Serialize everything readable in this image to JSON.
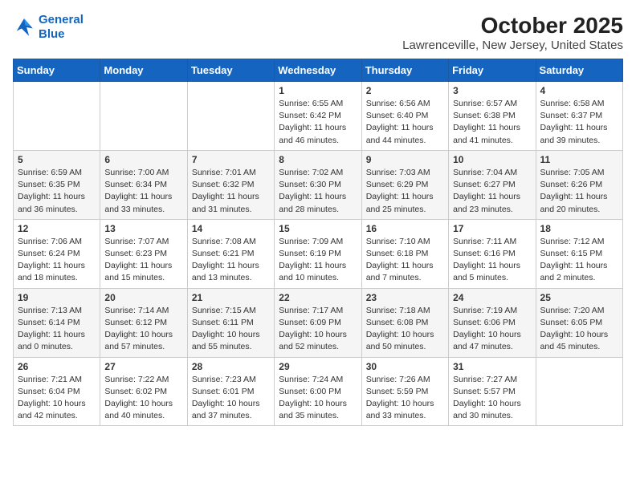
{
  "header": {
    "logo_line1": "General",
    "logo_line2": "Blue",
    "title": "October 2025",
    "subtitle": "Lawrenceville, New Jersey, United States"
  },
  "weekdays": [
    "Sunday",
    "Monday",
    "Tuesday",
    "Wednesday",
    "Thursday",
    "Friday",
    "Saturday"
  ],
  "weeks": [
    [
      {
        "day": "",
        "info": ""
      },
      {
        "day": "",
        "info": ""
      },
      {
        "day": "",
        "info": ""
      },
      {
        "day": "1",
        "info": "Sunrise: 6:55 AM\nSunset: 6:42 PM\nDaylight: 11 hours\nand 46 minutes."
      },
      {
        "day": "2",
        "info": "Sunrise: 6:56 AM\nSunset: 6:40 PM\nDaylight: 11 hours\nand 44 minutes."
      },
      {
        "day": "3",
        "info": "Sunrise: 6:57 AM\nSunset: 6:38 PM\nDaylight: 11 hours\nand 41 minutes."
      },
      {
        "day": "4",
        "info": "Sunrise: 6:58 AM\nSunset: 6:37 PM\nDaylight: 11 hours\nand 39 minutes."
      }
    ],
    [
      {
        "day": "5",
        "info": "Sunrise: 6:59 AM\nSunset: 6:35 PM\nDaylight: 11 hours\nand 36 minutes."
      },
      {
        "day": "6",
        "info": "Sunrise: 7:00 AM\nSunset: 6:34 PM\nDaylight: 11 hours\nand 33 minutes."
      },
      {
        "day": "7",
        "info": "Sunrise: 7:01 AM\nSunset: 6:32 PM\nDaylight: 11 hours\nand 31 minutes."
      },
      {
        "day": "8",
        "info": "Sunrise: 7:02 AM\nSunset: 6:30 PM\nDaylight: 11 hours\nand 28 minutes."
      },
      {
        "day": "9",
        "info": "Sunrise: 7:03 AM\nSunset: 6:29 PM\nDaylight: 11 hours\nand 25 minutes."
      },
      {
        "day": "10",
        "info": "Sunrise: 7:04 AM\nSunset: 6:27 PM\nDaylight: 11 hours\nand 23 minutes."
      },
      {
        "day": "11",
        "info": "Sunrise: 7:05 AM\nSunset: 6:26 PM\nDaylight: 11 hours\nand 20 minutes."
      }
    ],
    [
      {
        "day": "12",
        "info": "Sunrise: 7:06 AM\nSunset: 6:24 PM\nDaylight: 11 hours\nand 18 minutes."
      },
      {
        "day": "13",
        "info": "Sunrise: 7:07 AM\nSunset: 6:23 PM\nDaylight: 11 hours\nand 15 minutes."
      },
      {
        "day": "14",
        "info": "Sunrise: 7:08 AM\nSunset: 6:21 PM\nDaylight: 11 hours\nand 13 minutes."
      },
      {
        "day": "15",
        "info": "Sunrise: 7:09 AM\nSunset: 6:19 PM\nDaylight: 11 hours\nand 10 minutes."
      },
      {
        "day": "16",
        "info": "Sunrise: 7:10 AM\nSunset: 6:18 PM\nDaylight: 11 hours\nand 7 minutes."
      },
      {
        "day": "17",
        "info": "Sunrise: 7:11 AM\nSunset: 6:16 PM\nDaylight: 11 hours\nand 5 minutes."
      },
      {
        "day": "18",
        "info": "Sunrise: 7:12 AM\nSunset: 6:15 PM\nDaylight: 11 hours\nand 2 minutes."
      }
    ],
    [
      {
        "day": "19",
        "info": "Sunrise: 7:13 AM\nSunset: 6:14 PM\nDaylight: 11 hours\nand 0 minutes."
      },
      {
        "day": "20",
        "info": "Sunrise: 7:14 AM\nSunset: 6:12 PM\nDaylight: 10 hours\nand 57 minutes."
      },
      {
        "day": "21",
        "info": "Sunrise: 7:15 AM\nSunset: 6:11 PM\nDaylight: 10 hours\nand 55 minutes."
      },
      {
        "day": "22",
        "info": "Sunrise: 7:17 AM\nSunset: 6:09 PM\nDaylight: 10 hours\nand 52 minutes."
      },
      {
        "day": "23",
        "info": "Sunrise: 7:18 AM\nSunset: 6:08 PM\nDaylight: 10 hours\nand 50 minutes."
      },
      {
        "day": "24",
        "info": "Sunrise: 7:19 AM\nSunset: 6:06 PM\nDaylight: 10 hours\nand 47 minutes."
      },
      {
        "day": "25",
        "info": "Sunrise: 7:20 AM\nSunset: 6:05 PM\nDaylight: 10 hours\nand 45 minutes."
      }
    ],
    [
      {
        "day": "26",
        "info": "Sunrise: 7:21 AM\nSunset: 6:04 PM\nDaylight: 10 hours\nand 42 minutes."
      },
      {
        "day": "27",
        "info": "Sunrise: 7:22 AM\nSunset: 6:02 PM\nDaylight: 10 hours\nand 40 minutes."
      },
      {
        "day": "28",
        "info": "Sunrise: 7:23 AM\nSunset: 6:01 PM\nDaylight: 10 hours\nand 37 minutes."
      },
      {
        "day": "29",
        "info": "Sunrise: 7:24 AM\nSunset: 6:00 PM\nDaylight: 10 hours\nand 35 minutes."
      },
      {
        "day": "30",
        "info": "Sunrise: 7:26 AM\nSunset: 5:59 PM\nDaylight: 10 hours\nand 33 minutes."
      },
      {
        "day": "31",
        "info": "Sunrise: 7:27 AM\nSunset: 5:57 PM\nDaylight: 10 hours\nand 30 minutes."
      },
      {
        "day": "",
        "info": ""
      }
    ]
  ]
}
